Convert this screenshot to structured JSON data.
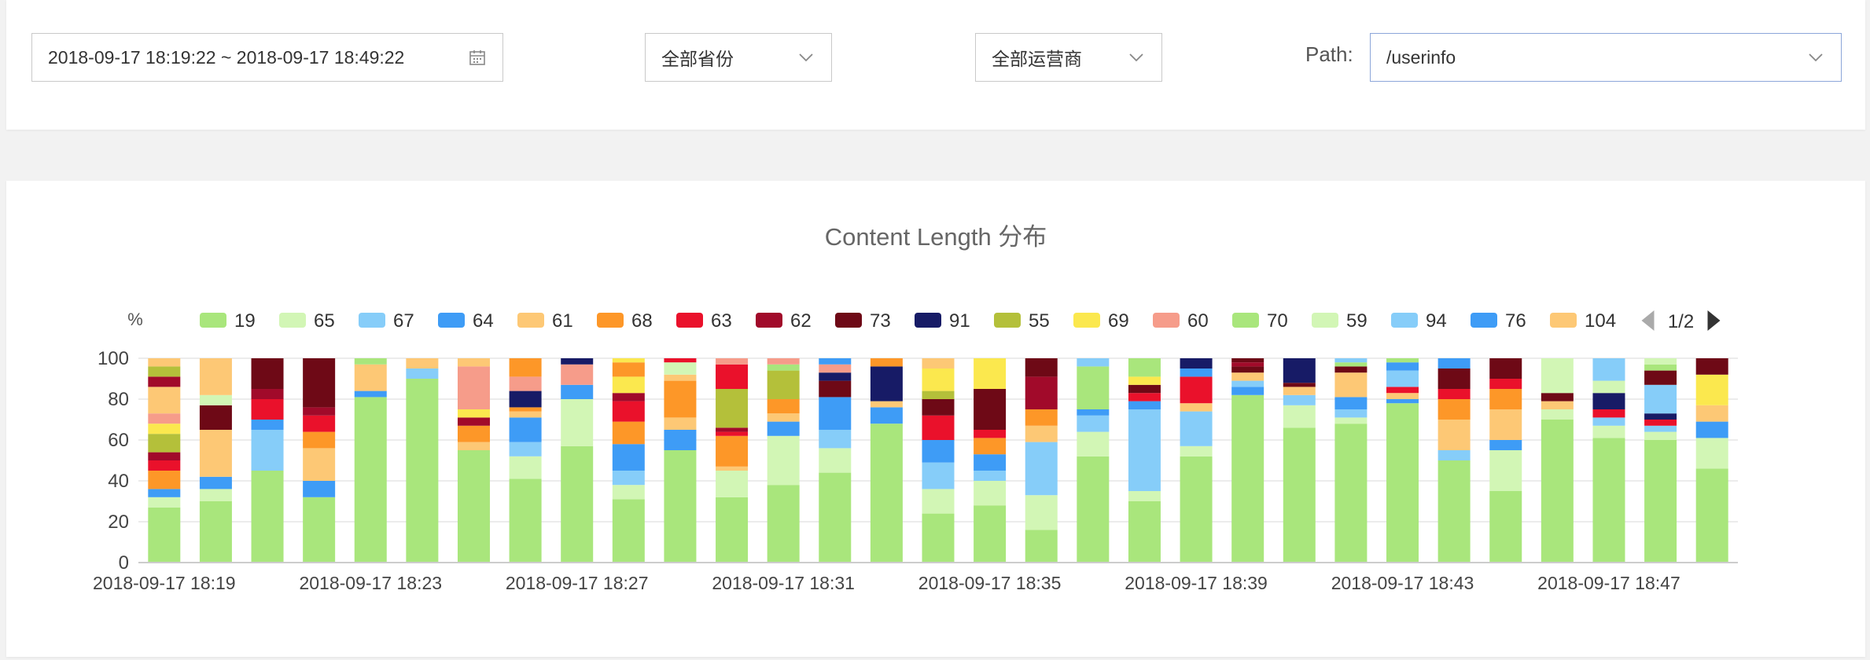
{
  "filters": {
    "date_range": "2018-09-17 18:19:22 ~ 2018-09-17 18:49:22",
    "province": "全部省份",
    "carrier": "全部运营商",
    "path_label": "Path:",
    "path_value": "/userinfo"
  },
  "chart_data": {
    "type": "bar",
    "stacked": true,
    "title": "Content Length 分布",
    "ylabel": "%",
    "ylim": [
      0,
      100
    ],
    "yticks": [
      0,
      20,
      40,
      60,
      80,
      100
    ],
    "grid": true,
    "legend_position": "top",
    "legend_page": "1/2",
    "x_tick_labels": [
      "2018-09-17 18:19",
      "2018-09-17 18:23",
      "2018-09-17 18:27",
      "2018-09-17 18:31",
      "2018-09-17 18:35",
      "2018-09-17 18:39",
      "2018-09-17 18:43",
      "2018-09-17 18:47"
    ],
    "categories": [
      "18:19",
      "18:20",
      "18:21",
      "18:22",
      "18:23",
      "18:24",
      "18:25",
      "18:26",
      "18:27",
      "18:28",
      "18:29",
      "18:30",
      "18:31",
      "18:32",
      "18:33",
      "18:34",
      "18:35",
      "18:36",
      "18:37",
      "18:38",
      "18:39",
      "18:40",
      "18:41",
      "18:42",
      "18:43",
      "18:44",
      "18:45",
      "18:46",
      "18:47",
      "18:48",
      "18:49"
    ],
    "legend": [
      {
        "name": "19",
        "color": "#a9e67c"
      },
      {
        "name": "65",
        "color": "#d2f6b5"
      },
      {
        "name": "67",
        "color": "#86cdf9"
      },
      {
        "name": "64",
        "color": "#3e9cf6"
      },
      {
        "name": "61",
        "color": "#fdc875"
      },
      {
        "name": "68",
        "color": "#fd9728"
      },
      {
        "name": "63",
        "color": "#ea112b"
      },
      {
        "name": "62",
        "color": "#a10a2a"
      },
      {
        "name": "73",
        "color": "#6e0916"
      },
      {
        "name": "91",
        "color": "#171b66"
      },
      {
        "name": "55",
        "color": "#b4c03a"
      },
      {
        "name": "69",
        "color": "#fbe84e"
      },
      {
        "name": "60",
        "color": "#f69c8a"
      },
      {
        "name": "70",
        "color": "#a9e67c"
      },
      {
        "name": "59",
        "color": "#d2f6b5"
      },
      {
        "name": "94",
        "color": "#86cdf9"
      },
      {
        "name": "76",
        "color": "#3e9cf6"
      },
      {
        "name": "104",
        "color": "#fdc875"
      }
    ],
    "stacks": [
      [
        [
          "19",
          27
        ],
        [
          "65",
          5
        ],
        [
          "64",
          4
        ],
        [
          "68",
          9
        ],
        [
          "63",
          5
        ],
        [
          "62",
          4
        ],
        [
          "55",
          9
        ],
        [
          "69",
          5
        ],
        [
          "60",
          5
        ],
        [
          "61",
          13
        ],
        [
          "62",
          5
        ],
        [
          "55",
          5
        ],
        [
          "61",
          4
        ]
      ],
      [
        [
          "19",
          30
        ],
        [
          "65",
          6
        ],
        [
          "64",
          6
        ],
        [
          "61",
          23
        ],
        [
          "73",
          12
        ],
        [
          "65",
          5
        ],
        [
          "61",
          18
        ]
      ],
      [
        [
          "19",
          45
        ],
        [
          "67",
          20
        ],
        [
          "64",
          5
        ],
        [
          "63",
          10
        ],
        [
          "62",
          5
        ],
        [
          "73",
          15
        ]
      ],
      [
        [
          "19",
          32
        ],
        [
          "64",
          8
        ],
        [
          "61",
          16
        ],
        [
          "68",
          8
        ],
        [
          "63",
          8
        ],
        [
          "62",
          4
        ],
        [
          "73",
          24
        ]
      ],
      [
        [
          "19",
          81
        ],
        [
          "64",
          3
        ],
        [
          "61",
          13
        ],
        [
          "19",
          3
        ]
      ],
      [
        [
          "19",
          90
        ],
        [
          "67",
          5
        ],
        [
          "61",
          5
        ]
      ],
      [
        [
          "19",
          55
        ],
        [
          "61",
          4
        ],
        [
          "68",
          8
        ],
        [
          "62",
          4
        ],
        [
          "69",
          4
        ],
        [
          "60",
          21
        ],
        [
          "61",
          4
        ]
      ],
      [
        [
          "19",
          41
        ],
        [
          "65",
          11
        ],
        [
          "67",
          7
        ],
        [
          "64",
          12
        ],
        [
          "61",
          3
        ],
        [
          "68",
          2
        ],
        [
          "91",
          8
        ],
        [
          "60",
          7
        ],
        [
          "68",
          9
        ]
      ],
      [
        [
          "19",
          57
        ],
        [
          "65",
          23
        ],
        [
          "64",
          7
        ],
        [
          "60",
          10
        ],
        [
          "91",
          3
        ]
      ],
      [
        [
          "19",
          31
        ],
        [
          "65",
          7
        ],
        [
          "67",
          7
        ],
        [
          "64",
          13
        ],
        [
          "68",
          11
        ],
        [
          "63",
          10
        ],
        [
          "62",
          4
        ],
        [
          "69",
          8
        ],
        [
          "68",
          7
        ],
        [
          "69",
          2
        ]
      ],
      [
        [
          "19",
          55
        ],
        [
          "64",
          10
        ],
        [
          "61",
          6
        ],
        [
          "68",
          18
        ],
        [
          "61",
          3
        ],
        [
          "65",
          6
        ],
        [
          "63",
          2
        ]
      ],
      [
        [
          "19",
          32
        ],
        [
          "65",
          13
        ],
        [
          "61",
          2
        ],
        [
          "68",
          15
        ],
        [
          "63",
          2
        ],
        [
          "62",
          2
        ],
        [
          "55",
          19
        ],
        [
          "63",
          12
        ],
        [
          "60",
          3
        ]
      ],
      [
        [
          "19",
          38
        ],
        [
          "65",
          24
        ],
        [
          "64",
          7
        ],
        [
          "61",
          4
        ],
        [
          "68",
          7
        ],
        [
          "55",
          14
        ],
        [
          "70",
          3
        ],
        [
          "60",
          3
        ]
      ],
      [
        [
          "19",
          44
        ],
        [
          "65",
          12
        ],
        [
          "67",
          9
        ],
        [
          "64",
          16
        ],
        [
          "73",
          8
        ],
        [
          "91",
          4
        ],
        [
          "60",
          4
        ],
        [
          "64",
          3
        ]
      ],
      [
        [
          "19",
          68
        ],
        [
          "64",
          8
        ],
        [
          "61",
          3
        ],
        [
          "91",
          17
        ],
        [
          "68",
          4
        ]
      ],
      [
        [
          "19",
          24
        ],
        [
          "65",
          12
        ],
        [
          "67",
          13
        ],
        [
          "64",
          11
        ],
        [
          "63",
          12
        ],
        [
          "73",
          8
        ],
        [
          "55",
          4
        ],
        [
          "69",
          11
        ],
        [
          "61",
          5
        ]
      ],
      [
        [
          "19",
          28
        ],
        [
          "65",
          12
        ],
        [
          "67",
          5
        ],
        [
          "64",
          8
        ],
        [
          "68",
          8
        ],
        [
          "63",
          4
        ],
        [
          "73",
          20
        ],
        [
          "69",
          15
        ]
      ],
      [
        [
          "19",
          16
        ],
        [
          "65",
          17
        ],
        [
          "67",
          26
        ],
        [
          "64",
          0
        ],
        [
          "61",
          8
        ],
        [
          "68",
          8
        ],
        [
          "62",
          16
        ],
        [
          "73",
          9
        ]
      ],
      [
        [
          "19",
          52
        ],
        [
          "65",
          12
        ],
        [
          "67",
          8
        ],
        [
          "64",
          3
        ],
        [
          "70",
          21
        ],
        [
          "94",
          4
        ]
      ],
      [
        [
          "19",
          30
        ],
        [
          "65",
          5
        ],
        [
          "67",
          40
        ],
        [
          "64",
          4
        ],
        [
          "63",
          4
        ],
        [
          "73",
          4
        ],
        [
          "69",
          4
        ],
        [
          "70",
          9
        ]
      ],
      [
        [
          "19",
          52
        ],
        [
          "65",
          5
        ],
        [
          "67",
          17
        ],
        [
          "61",
          4
        ],
        [
          "63",
          13
        ],
        [
          "64",
          4
        ],
        [
          "91",
          5
        ]
      ],
      [
        [
          "19",
          82
        ],
        [
          "64",
          4
        ],
        [
          "67",
          3
        ],
        [
          "61",
          4
        ],
        [
          "73",
          3
        ],
        [
          "62",
          2
        ],
        [
          "73",
          2
        ]
      ],
      [
        [
          "19",
          66
        ],
        [
          "65",
          11
        ],
        [
          "67",
          5
        ],
        [
          "61",
          4
        ],
        [
          "73",
          2
        ],
        [
          "91",
          12
        ]
      ],
      [
        [
          "19",
          68
        ],
        [
          "65",
          3
        ],
        [
          "67",
          4
        ],
        [
          "64",
          6
        ],
        [
          "61",
          12
        ],
        [
          "73",
          3
        ],
        [
          "70",
          2
        ],
        [
          "94",
          2
        ]
      ],
      [
        [
          "19",
          78
        ],
        [
          "64",
          2
        ],
        [
          "61",
          3
        ],
        [
          "63",
          3
        ],
        [
          "67",
          8
        ],
        [
          "64",
          4
        ],
        [
          "70",
          2
        ]
      ],
      [
        [
          "19",
          50
        ],
        [
          "67",
          5
        ],
        [
          "61",
          15
        ],
        [
          "68",
          10
        ],
        [
          "63",
          5
        ],
        [
          "73",
          10
        ],
        [
          "76",
          5
        ]
      ],
      [
        [
          "19",
          35
        ],
        [
          "65",
          20
        ],
        [
          "64",
          5
        ],
        [
          "61",
          15
        ],
        [
          "68",
          10
        ],
        [
          "63",
          5
        ],
        [
          "73",
          10
        ]
      ],
      [
        [
          "19",
          70
        ],
        [
          "65",
          5
        ],
        [
          "61",
          4
        ],
        [
          "73",
          4
        ],
        [
          "59",
          17
        ]
      ],
      [
        [
          "19",
          61
        ],
        [
          "65",
          6
        ],
        [
          "67",
          4
        ],
        [
          "63",
          4
        ],
        [
          "91",
          8
        ],
        [
          "65",
          6
        ],
        [
          "94",
          11
        ]
      ],
      [
        [
          "19",
          60
        ],
        [
          "65",
          4
        ],
        [
          "67",
          3
        ],
        [
          "63",
          3
        ],
        [
          "91",
          3
        ],
        [
          "67",
          14
        ],
        [
          "73",
          7
        ],
        [
          "70",
          3
        ],
        [
          "59",
          3
        ]
      ],
      [
        [
          "19",
          46
        ],
        [
          "65",
          15
        ],
        [
          "64",
          8
        ],
        [
          "61",
          8
        ],
        [
          "69",
          15
        ],
        [
          "73",
          8
        ]
      ]
    ]
  }
}
